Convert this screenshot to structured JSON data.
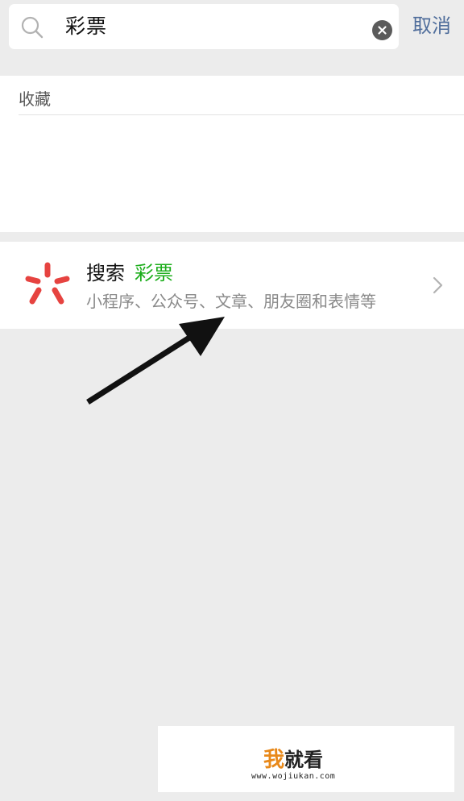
{
  "search": {
    "value": "彩票",
    "cancel_label": "取消"
  },
  "favorites": {
    "title": "收藏"
  },
  "result": {
    "prefix": "搜索",
    "keyword": "彩票",
    "subtitle": "小程序、公众号、文章、朋友圈和表情等"
  },
  "watermark": {
    "logo_char": "我",
    "logo_rest": "就看",
    "url": "www.wojiukan.com"
  },
  "colors": {
    "background": "#ececec",
    "accent_green": "#1aad19",
    "cancel_blue": "#4f6d9b",
    "logo_red": "#e64340",
    "watermark_orange": "#e8891a"
  },
  "icons": {
    "search": "search-icon",
    "clear": "clear-icon",
    "result_logo": "search-logo-icon",
    "chevron": "chevron-right-icon",
    "annotation": "arrow-annotation"
  }
}
